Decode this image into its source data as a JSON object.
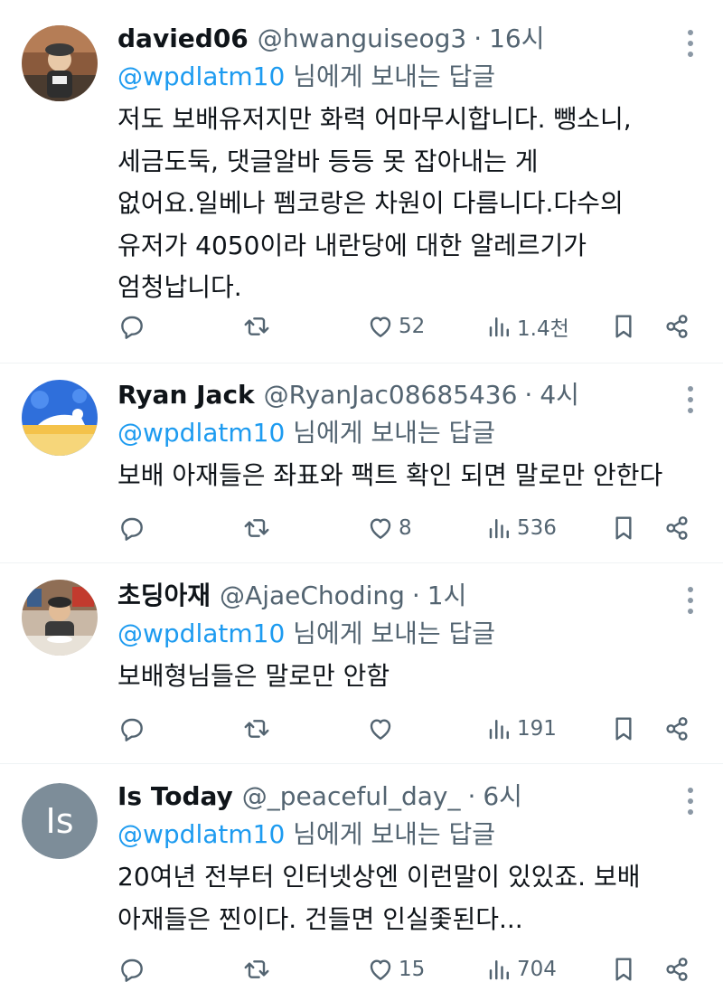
{
  "colors": {
    "link": "#1d9bf0",
    "secondary_text": "#536471",
    "primary_text": "#0f1419",
    "divider": "#eff3f4"
  },
  "tweets": [
    {
      "display_name": "davied06",
      "handle": "@hwanguiseog3",
      "separator": "·",
      "time": "16시",
      "reply_to_handle": "@wpdlatm10",
      "reply_suffix": " 님에게 보내는 답글",
      "body": "저도 보배유저지만 화력 어마무시합니다. 뺑소니,\n세금도둑, 댓글알바 등등 못 잡아내는 게\n없어요.일베나 펨코랑은 차원이 다름니다.다수의\n유저가 4050이라 내란당에 대한 알레르기가\n엄청납니다.",
      "avatar_icon": "photo-avatar-person-with-hat",
      "likes": "52",
      "views": "1.4천"
    },
    {
      "display_name": "Ryan Jack",
      "handle": "@RyanJac08685436",
      "separator": "·",
      "time": "4시",
      "reply_to_handle": "@wpdlatm10",
      "reply_suffix": " 님에게 보내는 답글",
      "body": "보배 아재들은 좌표와 팩트 확인 되면 말로만 안한다",
      "avatar_icon": "illustration-avatar-blue-sky",
      "likes": "8",
      "views": "536"
    },
    {
      "display_name": "초딩아재",
      "handle": "@AjaeChoding",
      "separator": "·",
      "time": "1시",
      "reply_to_handle": "@wpdlatm10",
      "reply_suffix": " 님에게 보내는 답글",
      "body": "보배형님들은 말로만 안함",
      "avatar_icon": "photo-avatar-person-at-table",
      "likes": "",
      "views": "191"
    },
    {
      "display_name": "Is Today",
      "handle": "@_peaceful_day_",
      "separator": "·",
      "time": "6시",
      "reply_to_handle": "@wpdlatm10",
      "reply_suffix": " 님에게 보내는 답글",
      "body": "20여년 전부터 인터넷상엔 이런말이 있있죠. 보배\n아재들은 찐이다. 건들면 인실좇된다...",
      "avatar_initials": "Is",
      "likes": "15",
      "views": "704"
    }
  ]
}
